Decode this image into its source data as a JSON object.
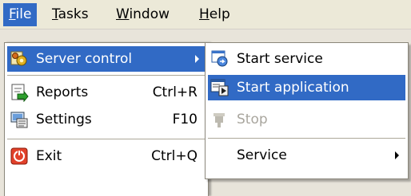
{
  "menubar": {
    "items": [
      {
        "label": "File",
        "mnemonic": "F",
        "rest": "ile"
      },
      {
        "label": "Tasks",
        "mnemonic": "T",
        "rest": "asks"
      },
      {
        "label": "Window",
        "mnemonic": "W",
        "rest": "indow"
      },
      {
        "label": "Help",
        "mnemonic": "H",
        "rest": "elp"
      }
    ]
  },
  "file_menu": {
    "items": [
      {
        "label": "Server control",
        "icon": "server-control-icon",
        "has_submenu": true,
        "highlighted": true
      },
      {
        "label": "Reports",
        "shortcut": "Ctrl+R",
        "icon": "reports-icon"
      },
      {
        "label": "Settings",
        "shortcut": "F10",
        "icon": "settings-icon"
      },
      {
        "label": "Exit",
        "shortcut": "Ctrl+Q",
        "icon": "exit-icon"
      }
    ]
  },
  "server_submenu": {
    "items": [
      {
        "label": "Start service",
        "icon": "start-service-icon"
      },
      {
        "label": "Start application",
        "icon": "start-application-icon",
        "highlighted": true
      },
      {
        "label": "Stop",
        "icon": "stop-icon",
        "disabled": true
      },
      {
        "label": "Service",
        "has_submenu": true
      }
    ]
  },
  "colors": {
    "highlight": "#316ac5",
    "menubar": "#ece9d8",
    "disabled_text": "#a9a69e"
  }
}
